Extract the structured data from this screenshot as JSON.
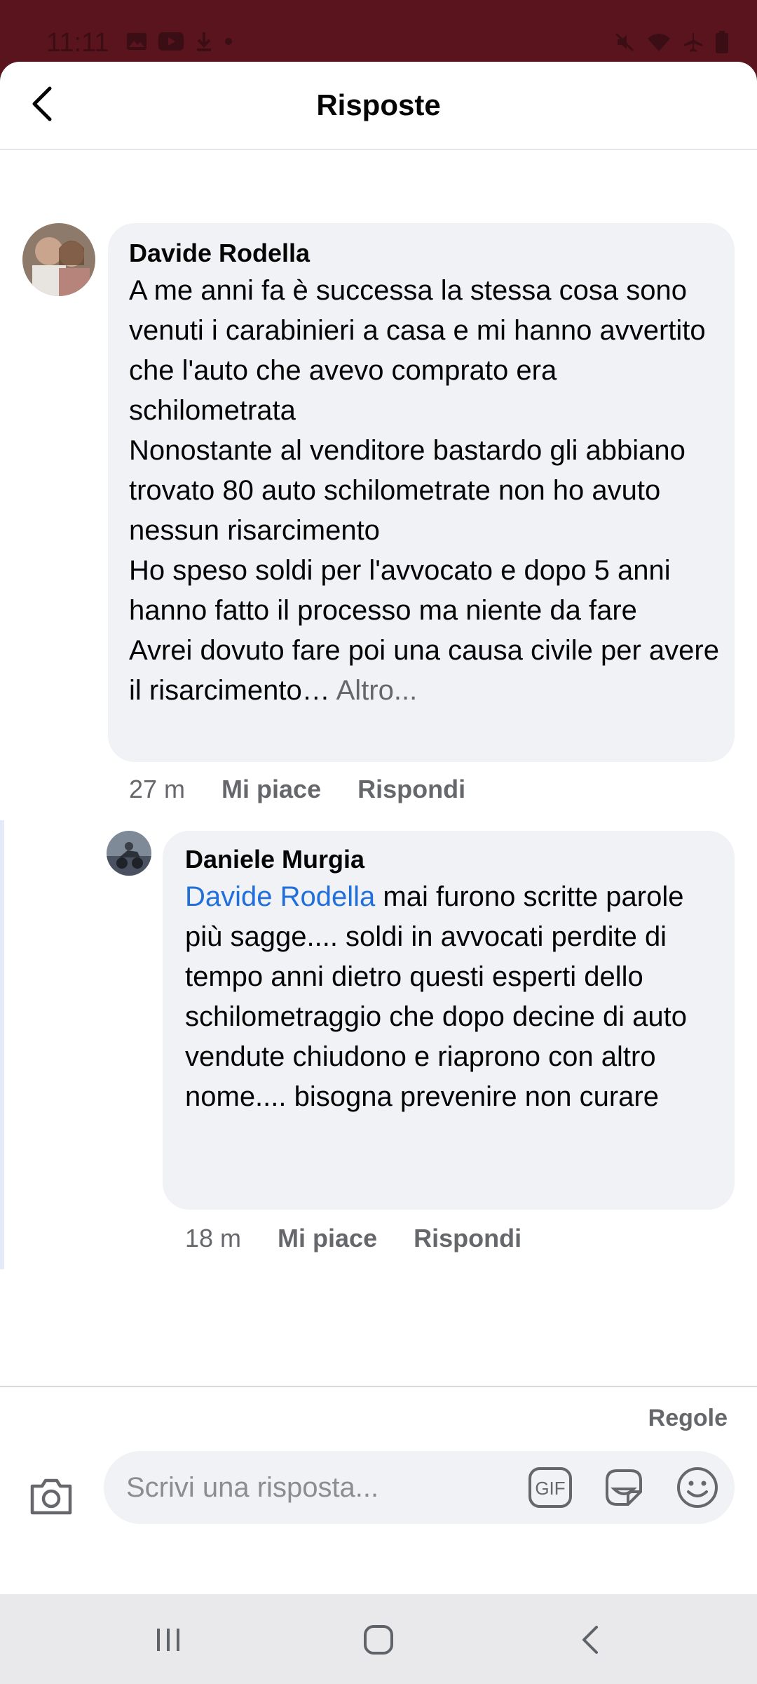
{
  "status_bar": {
    "time": "11:11"
  },
  "header": {
    "title": "Risposte"
  },
  "comment": {
    "author": "Davide Rodella",
    "text": "A me anni fa è successa la stessa cosa sono venuti i carabinieri a casa e mi hanno avvertito che l'auto che avevo comprato era schilometrata\nNonostante al venditore bastardo gli abbiano trovato 80 auto schilometrate non ho avuto nessun risarcimento\nHo speso soldi per l'avvocato e dopo 5 anni hanno fatto il processo ma niente da fare\nAvrei dovuto fare poi una causa civile per avere il risarcimento…",
    "more_label": " Altro...",
    "time": "27 m",
    "like_label": "Mi piace",
    "reply_label": "Rispondi"
  },
  "reply": {
    "author": "Daniele Murgia",
    "mention": "Davide Rodella",
    "text": " mai furono scritte parole più sagge.... soldi in avvocati perdite di tempo anni dietro questi esperti dello schilometraggio che dopo decine di auto vendute chiudono e riaprono con altro nome.... bisogna prevenire non curare",
    "time": "18 m",
    "like_label": "Mi piace",
    "reply_label": "Rispondi"
  },
  "composer": {
    "rules_label": "Regole",
    "placeholder": "Scrivi una risposta...",
    "gif_label": "GIF"
  },
  "colors": {
    "status_bar_bg": "#5a141e",
    "bubble_bg": "#f0f2f5",
    "mention": "#216fdb",
    "secondary_text": "#65676b"
  }
}
